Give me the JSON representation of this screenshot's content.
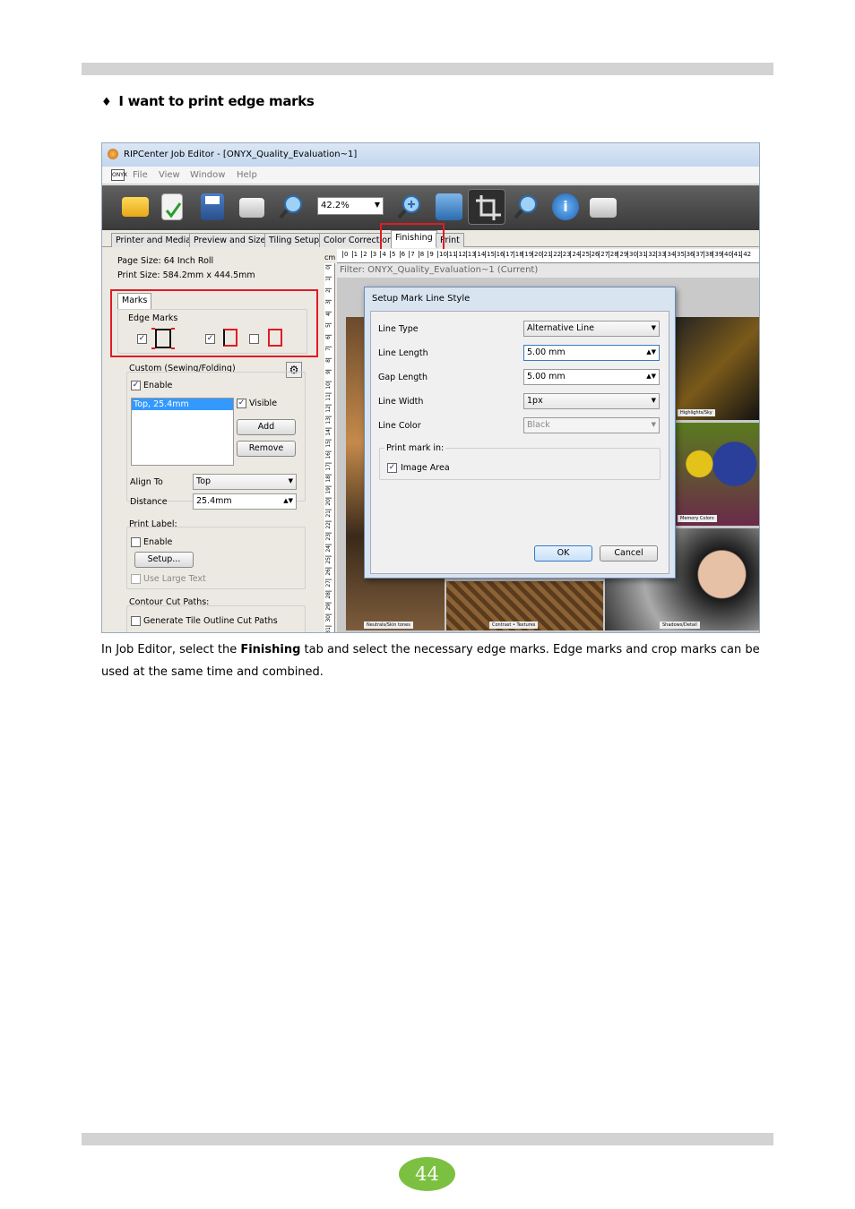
{
  "heading": {
    "bullet": "♦",
    "text": "I want to print edge marks"
  },
  "window": {
    "title": "RIPCenter Job Editor - [ONYX_Quality_Evaluation~1]",
    "menu": [
      "File",
      "View",
      "Window",
      "Help"
    ],
    "onyx_logo": "ONYX",
    "zoom": "42.2%",
    "tabs": [
      "Printer and Media",
      "Preview and Size",
      "Tiling Setup",
      "Color Correction",
      "Finishing",
      "Print"
    ],
    "active_tab": "Finishing"
  },
  "left_panel": {
    "page_size": "Page Size: 64 Inch Roll",
    "print_size": "Print Size: 584.2mm x 444.5mm",
    "marks_tab": "Marks",
    "edge_marks": {
      "label": "Edge Marks",
      "checked": [
        true,
        true,
        false
      ]
    },
    "custom": {
      "label": "Custom (Sewing/Folding)",
      "enable_label": "Enable",
      "enable_checked": true,
      "list_item": "Top, 25.4mm",
      "visible_label": "Visible",
      "visible_checked": true,
      "add": "Add",
      "remove": "Remove",
      "align_label": "Align To",
      "align_value": "Top",
      "distance_label": "Distance",
      "distance_value": "25.4mm"
    },
    "print_label": {
      "label": "Print Label:",
      "enable_label": "Enable",
      "setup": "Setup...",
      "large_text": "Use Large Text"
    },
    "contour": {
      "label": "Contour Cut Paths:",
      "generate": "Generate Tile Outline Cut Paths"
    }
  },
  "ruler": {
    "unit": "cm",
    "h_ticks": [
      "0",
      "1",
      "2",
      "3",
      "4",
      "5",
      "6",
      "7",
      "8",
      "9",
      "10",
      "11",
      "12",
      "13",
      "14",
      "15",
      "16",
      "17",
      "18",
      "19",
      "20",
      "21",
      "22",
      "23",
      "24",
      "25",
      "26",
      "27",
      "28",
      "29",
      "30",
      "31",
      "32",
      "33",
      "34",
      "35",
      "36",
      "37",
      "38",
      "39",
      "40",
      "41",
      "42"
    ],
    "v_ticks": [
      "0",
      "1",
      "2",
      "3",
      "4",
      "5",
      "6",
      "7",
      "8",
      "9",
      "10",
      "11",
      "12",
      "13",
      "14",
      "15",
      "16",
      "17",
      "18",
      "19",
      "20",
      "21",
      "22",
      "23",
      "24",
      "25",
      "26",
      "27",
      "28",
      "29",
      "30",
      "31"
    ]
  },
  "canvas": {
    "filter": "Filter: ONYX_Quality_Evaluation~1 (Current)",
    "captions": [
      "Neutrals/Skin tones",
      "Contrast • Textures",
      "Shadows/Detail",
      "Memory Colors",
      "Highlights/Sky"
    ]
  },
  "dialog": {
    "title": "Setup Mark Line Style",
    "line_type_label": "Line Type",
    "line_type_value": "Alternative Line",
    "line_length_label": "Line Length",
    "line_length_value": "5.00 mm",
    "gap_length_label": "Gap Length",
    "gap_length_value": "5.00 mm",
    "line_width_label": "Line Width",
    "line_width_value": "1px",
    "line_color_label": "Line Color",
    "line_color_value": "Black",
    "print_mark_in": "Print mark in:",
    "image_area_label": "Image Area",
    "image_area_checked": true,
    "ok": "OK",
    "cancel": "Cancel"
  },
  "paragraph": {
    "before": "In Job Editor, select the ",
    "bold": "Finishing",
    "after": " tab and select the necessary edge marks. Edge marks and crop marks can be used at the same time and combined."
  },
  "page_number": "44",
  "colors": {
    "highlight": "#e01b24",
    "badge": "#7cc042",
    "rule": "#d3d3d3"
  }
}
